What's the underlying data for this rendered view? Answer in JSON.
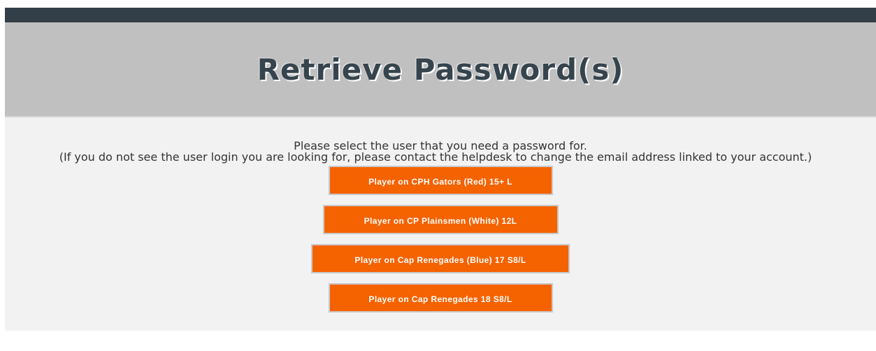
{
  "header": {
    "title": "Retrieve Password(s)"
  },
  "instructions": {
    "line1": "Please select the user that you need a password for.",
    "line2": "(If you do not see the user login you are looking for, please contact the helpdesk to change the email address linked to your account.)"
  },
  "users": [
    {
      "label": "Player on CPH Gators (Red) 15+ L"
    },
    {
      "label": "Player on CP Plainsmen (White) 12L"
    },
    {
      "label": "Player on Cap Renegades (Blue) 17 S8/L"
    },
    {
      "label": "Player on Cap Renegades 18 S8/L"
    }
  ],
  "colors": {
    "topbar": "#333f48",
    "header_bg": "#c0c0c0",
    "title_text": "#36444d",
    "page_bg": "#f2f2f2",
    "button_bg": "#f56200",
    "button_text": "#ffffff"
  }
}
